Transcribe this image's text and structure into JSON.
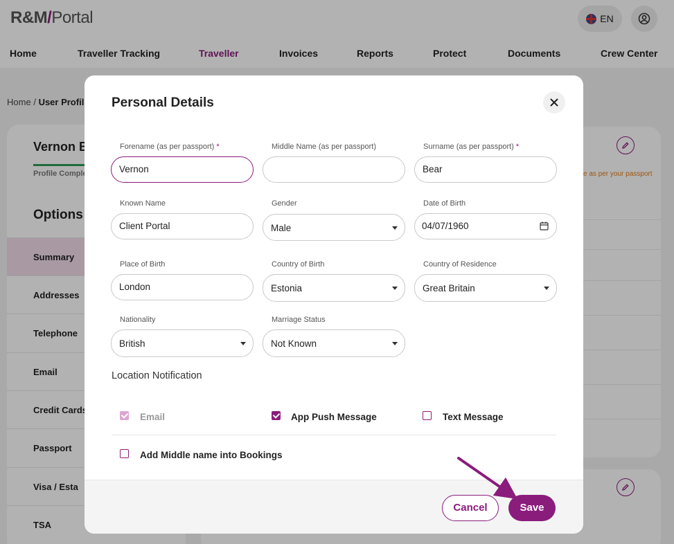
{
  "header": {
    "logo_brand": "R&M",
    "logo_slash": "/",
    "logo_product": "Portal",
    "language": "EN"
  },
  "nav": [
    "Home",
    "Traveller Tracking",
    "Traveller",
    "Invoices",
    "Reports",
    "Protect",
    "Documents",
    "Crew Center"
  ],
  "breadcrumb": {
    "home": "Home",
    "sep": "/",
    "current": "User Profil"
  },
  "sidebar": {
    "name": "Vernon B",
    "completion_label": "Profile Comple",
    "options_title": "Options",
    "items": [
      "Summary",
      "Addresses",
      "Telephone",
      "Email",
      "Credit Cards",
      "Passport",
      "Visa / Esta",
      "TSA"
    ]
  },
  "background": {
    "warning": "e as per your passport"
  },
  "modal": {
    "title": "Personal Details",
    "fields": {
      "forename": {
        "label": "Forename (as per passport)",
        "required": "*",
        "value": "Vernon"
      },
      "middle_name": {
        "label": "Middle Name (as per passport)",
        "value": ""
      },
      "surname": {
        "label": "Surname (as per passport)",
        "required": "*",
        "value": "Bear"
      },
      "known_name": {
        "label": "Known Name",
        "value": "Client Portal"
      },
      "gender": {
        "label": "Gender",
        "value": "Male"
      },
      "dob": {
        "label": "Date of Birth",
        "value": "04/07/1960"
      },
      "place_of_birth": {
        "label": "Place of Birth",
        "value": "London"
      },
      "country_of_birth": {
        "label": "Country of Birth",
        "value": "Estonia"
      },
      "country_of_residence": {
        "label": "Country of Residence",
        "value": "Great Britain"
      },
      "nationality": {
        "label": "Nationality",
        "value": "British"
      },
      "marriage_status": {
        "label": "Marriage Status",
        "value": "Not Known"
      }
    },
    "location_notification": {
      "title": "Location Notification",
      "email": "Email",
      "app_push": "App Push Message",
      "text_message": "Text Message"
    },
    "middle_name_bookings": "Add Middle name into Bookings",
    "cancel": "Cancel",
    "save": "Save"
  },
  "colors": {
    "accent": "#8a1c7c",
    "progress": "#2e9a57",
    "warning": "#e07b18"
  }
}
